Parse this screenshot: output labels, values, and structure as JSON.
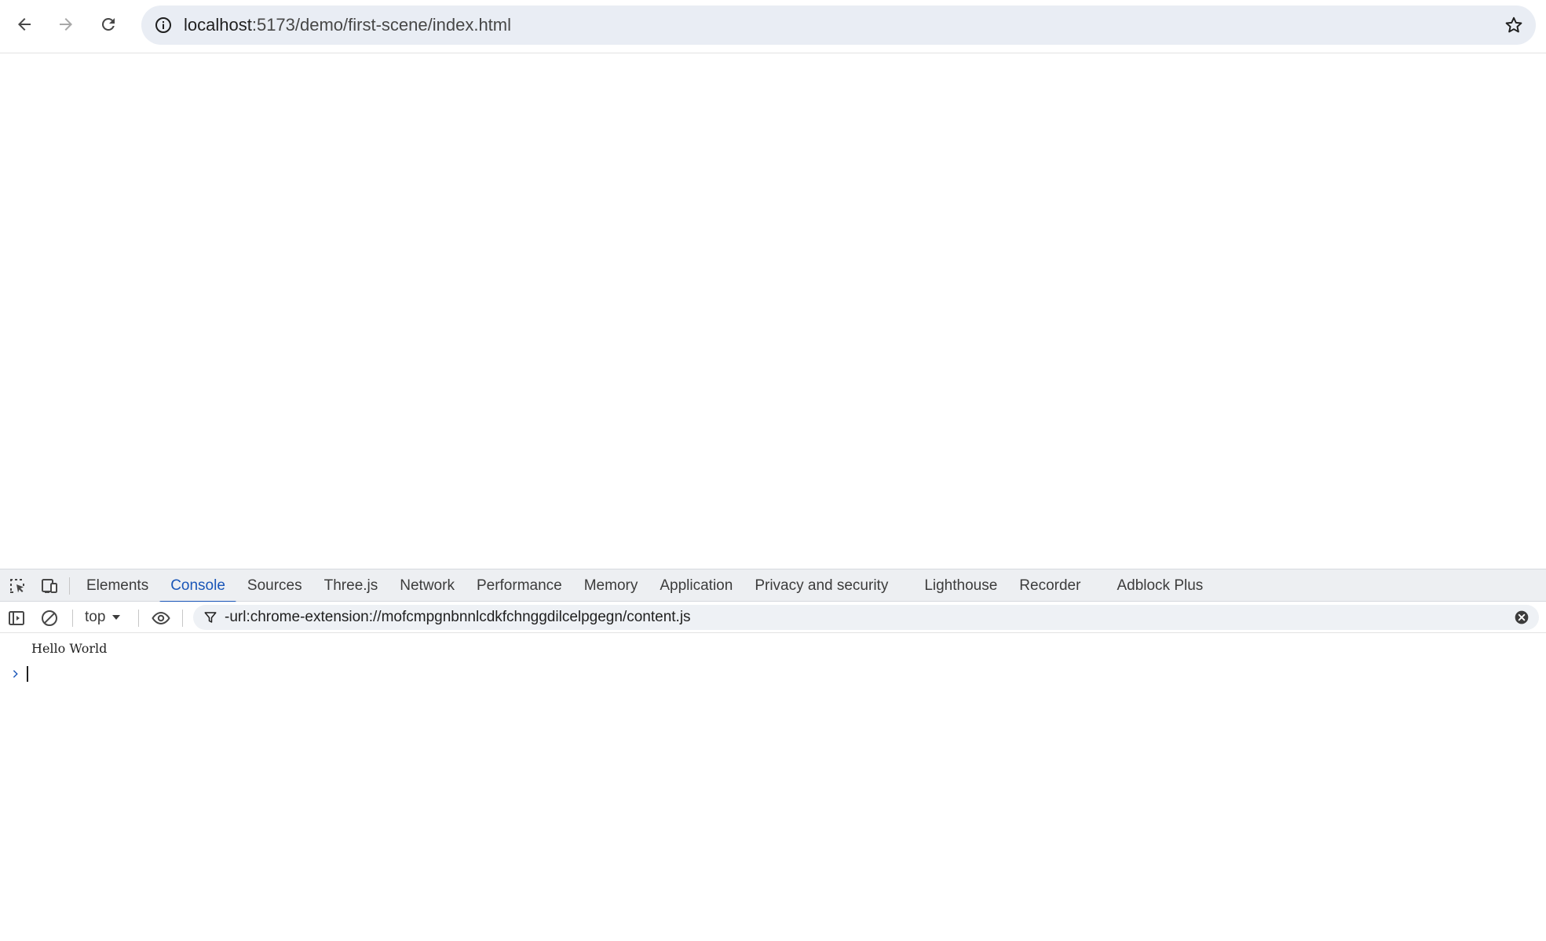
{
  "browser": {
    "nav": {
      "back_icon": "arrow-left-icon",
      "forward_icon": "arrow-right-icon",
      "reload_icon": "reload-icon"
    },
    "address_bar": {
      "site_info_icon": "info-icon",
      "url_host": "localhost",
      "url_path": ":5173/demo/first-scene/index.html",
      "bookmark_icon": "star-icon"
    }
  },
  "devtools": {
    "tabs": [
      {
        "label": "Elements"
      },
      {
        "label": "Console",
        "active": true
      },
      {
        "label": "Sources"
      },
      {
        "label": "Three.js"
      },
      {
        "label": "Network"
      },
      {
        "label": "Performance"
      },
      {
        "label": "Memory"
      },
      {
        "label": "Application"
      },
      {
        "label": "Privacy and security"
      },
      {
        "label": "Lighthouse"
      },
      {
        "label": "Recorder"
      },
      {
        "label": "Adblock Plus"
      }
    ],
    "console": {
      "context": "top",
      "filter": "-url:chrome-extension://mofcmpgnbnnlcdkfchnggdilcelpgegn/content.js",
      "messages": [
        "Hello World"
      ],
      "prompt_value": ""
    },
    "colors": {
      "accent": "#1a56b8",
      "tabbar_bg": "#edeff2"
    }
  }
}
